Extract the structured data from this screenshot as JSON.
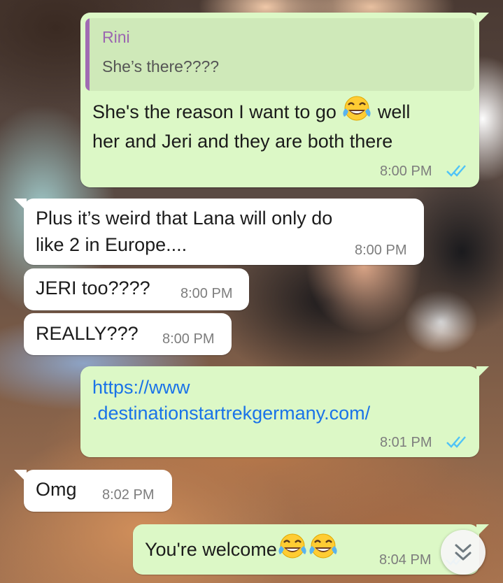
{
  "chat": {
    "messages": [
      {
        "direction": "outgoing",
        "quote": {
          "author": "Rini",
          "text": "She’s there????"
        },
        "lines": [
          "She's the reason I want to go",
          "well",
          "her and Jeri and they are both there"
        ],
        "time": "8:00 PM",
        "status": "read"
      },
      {
        "direction": "incoming",
        "lines": [
          "Plus it’s weird that Lana will only do",
          "like 2 in Europe...."
        ],
        "time": "8:00 PM"
      },
      {
        "direction": "incoming",
        "lines": [
          "JERI too????"
        ],
        "time": "8:00 PM"
      },
      {
        "direction": "incoming",
        "lines": [
          "REALLY???"
        ],
        "time": "8:00 PM"
      },
      {
        "direction": "outgoing",
        "lines": [
          "https://www",
          ".destinationstartrekgermany.com/"
        ],
        "is_link": true,
        "time": "8:01 PM",
        "status": "read"
      },
      {
        "direction": "incoming",
        "lines": [
          "Omg"
        ],
        "time": "8:02 PM"
      },
      {
        "direction": "outgoing",
        "lines": [
          "You're welcome"
        ],
        "emoji": [
          "face-with-tears-of-joy",
          "face-with-tears-of-joy"
        ],
        "time": "8:04 PM",
        "status": "read"
      }
    ],
    "scroll_down_icon": "double-chevron-down-icon",
    "colors": {
      "outgoing_bubble": "#dcf8c6",
      "incoming_bubble": "#ffffff",
      "read_ticks": "#4fc3f7",
      "quote_author": "#9b66b0",
      "link": "#1a73e8"
    }
  }
}
